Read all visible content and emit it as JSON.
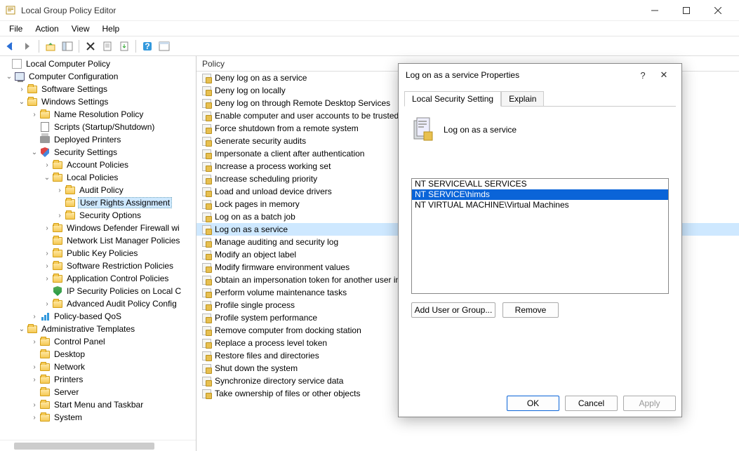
{
  "window": {
    "title": "Local Group Policy Editor"
  },
  "menus": [
    "File",
    "Action",
    "View",
    "Help"
  ],
  "tree": {
    "root": "Local Computer Policy",
    "cc": "Computer Configuration",
    "ss": "Software Settings",
    "ws": "Windows Settings",
    "nrp": "Name Resolution Policy",
    "scr": "Scripts (Startup/Shutdown)",
    "dp": "Deployed Printers",
    "sec": "Security Settings",
    "ap": "Account Policies",
    "lp": "Local Policies",
    "aud": "Audit Policy",
    "ura": "User Rights Assignment",
    "so": "Security Options",
    "wdf": "Windows Defender Firewall wi",
    "nlm": "Network List Manager Policies",
    "pkp": "Public Key Policies",
    "srp": "Software Restriction Policies",
    "acp": "Application Control Policies",
    "ips": "IP Security Policies on Local C",
    "aap": "Advanced Audit Policy Config",
    "pbq": "Policy-based QoS",
    "at": "Administrative Templates",
    "cp": "Control Panel",
    "dk": "Desktop",
    "nw": "Network",
    "pr": "Printers",
    "sv": "Server",
    "smt": "Start Menu and Taskbar",
    "sys": "System"
  },
  "list": {
    "col": "Policy",
    "items": [
      "Deny log on as a service",
      "Deny log on locally",
      "Deny log on through Remote Desktop Services",
      "Enable computer and user accounts to be trusted",
      "Force shutdown from a remote system",
      "Generate security audits",
      "Impersonate a client after authentication",
      "Increase a process working set",
      "Increase scheduling priority",
      "Load and unload device drivers",
      "Lock pages in memory",
      "Log on as a batch job",
      "Log on as a service",
      "Manage auditing and security log",
      "Modify an object label",
      "Modify firmware environment values",
      "Obtain an impersonation token for another user in",
      "Perform volume maintenance tasks",
      "Profile single process",
      "Profile system performance",
      "Remove computer from docking station",
      "Replace a process level token",
      "Restore files and directories",
      "Shut down the system",
      "Synchronize directory service data",
      "Take ownership of files or other objects"
    ],
    "selectedIndex": 12
  },
  "dialog": {
    "title": "Log on as a service Properties",
    "tab1": "Local Security Setting",
    "tab2": "Explain",
    "heading": "Log on as a service",
    "entries": [
      "NT SERVICE\\ALL SERVICES",
      "NT SERVICE\\himds",
      "NT VIRTUAL MACHINE\\Virtual Machines"
    ],
    "selectedEntry": 1,
    "addBtn": "Add User or Group...",
    "removeBtn": "Remove",
    "ok": "OK",
    "cancel": "Cancel",
    "apply": "Apply"
  }
}
